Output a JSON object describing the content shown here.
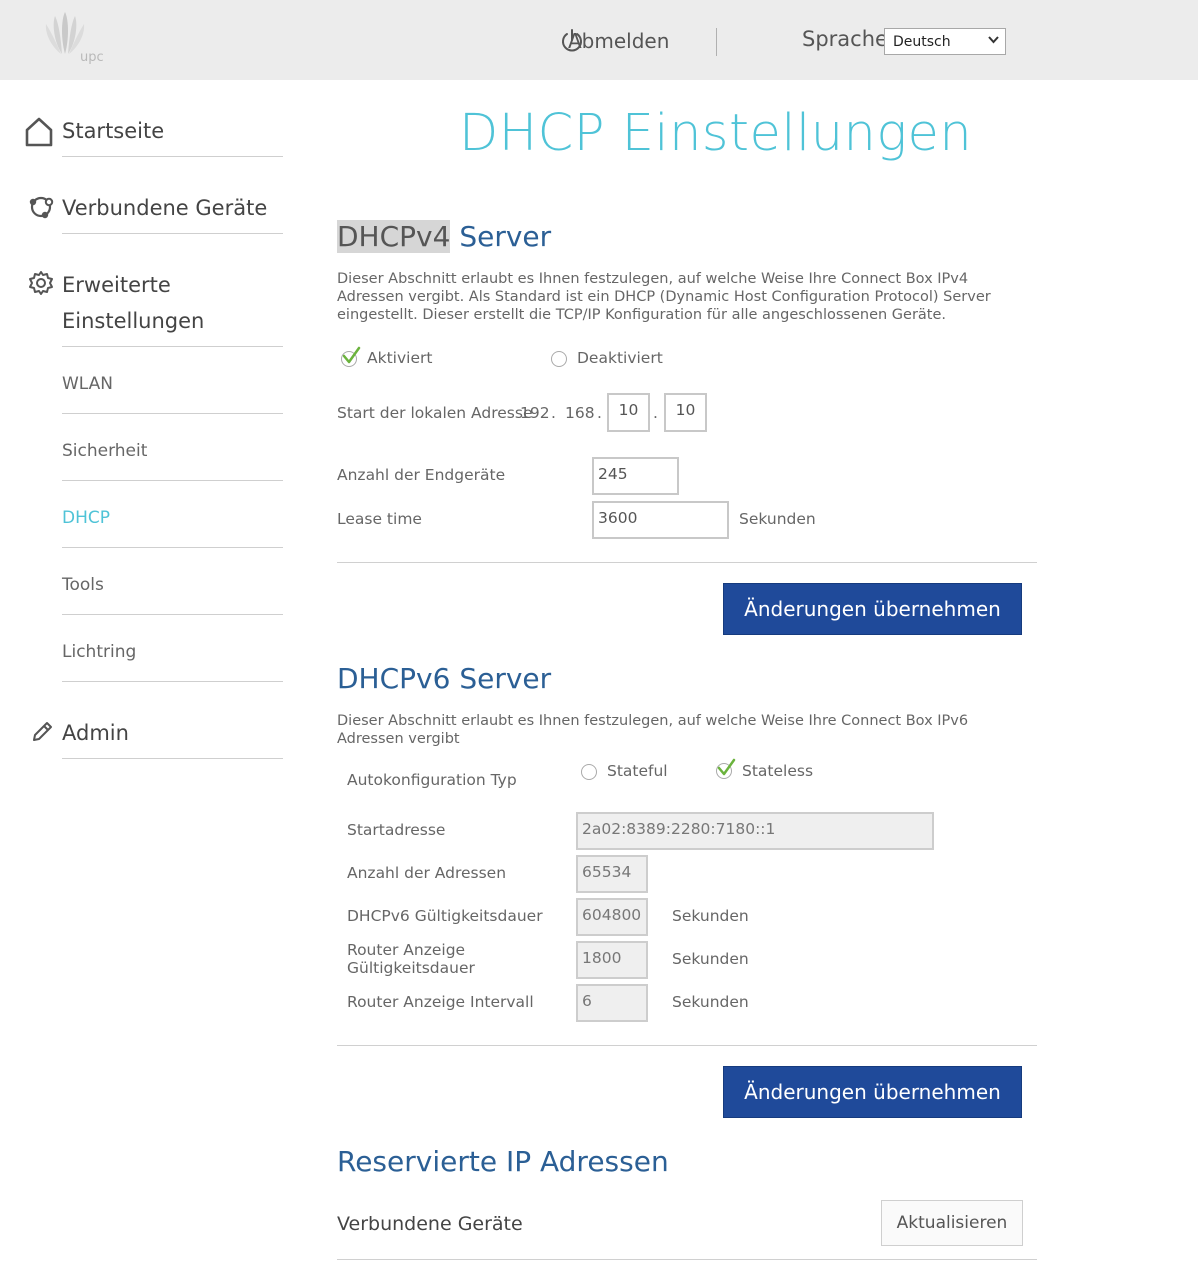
{
  "header": {
    "logo_text": "upc",
    "logout_label": "Abmelden",
    "language_label": "Sprache",
    "language_selected": "Deutsch"
  },
  "sidebar": {
    "items": [
      {
        "label": "Startseite"
      },
      {
        "label": "Verbundene Geräte"
      },
      {
        "label": "Erweiterte",
        "label2": "Einstellungen"
      },
      {
        "label": "WLAN"
      },
      {
        "label": "Sicherheit"
      },
      {
        "label": "DHCP"
      },
      {
        "label": "Tools"
      },
      {
        "label": "Lichtring"
      },
      {
        "label": "Admin"
      }
    ],
    "active_color": "#4fc3d7"
  },
  "main": {
    "title": "DHCP Einstellungen",
    "dhcpv4": {
      "title_highlight": "DHCPv4",
      "title_rest": " Server",
      "description": "Dieser Abschnitt erlaubt es Ihnen festzulegen, auf welche Weise Ihre Connect Box IPv4 Adressen vergibt. Als Standard ist ein DHCP (Dynamic Host Configuration Protocol) Server eingestellt. Dieser erstellt die TCP/IP Konfiguration für alle angeschlossenen Geräte.",
      "radio_enabled": "Aktiviert",
      "radio_disabled": "Deaktiviert",
      "selected": "Aktiviert",
      "start_address_label": "Start der lokalen Adresse",
      "ip_oct1": "192",
      "ip_dot1": ".",
      "ip_oct2": "168",
      "ip_dot2": ".",
      "ip_oct3": "10",
      "ip_dot3": ".",
      "ip_oct4": "10",
      "devices_label": "Anzahl der Endgeräte",
      "devices_value": "245",
      "lease_label": "Lease time",
      "lease_value": "3600",
      "lease_unit": "Sekunden",
      "apply_button": "Änderungen übernehmen"
    },
    "dhcpv6": {
      "title": "DHCPv6 Server",
      "description": "Dieser Abschnitt erlaubt es Ihnen festzulegen, auf welche Weise Ihre Connect Box IPv6 Adressen vergibt",
      "autoconf_label": "Autokonfiguration Typ",
      "radio_stateful": "Stateful",
      "radio_stateless": "Stateless",
      "selected": "Stateless",
      "start_label": "Startadresse",
      "start_value": "2a02:8389:2280:7180::1",
      "count_label": "Anzahl der Adressen",
      "count_value": "65534",
      "validity_label": "DHCPv6 Gültigkeitsdauer",
      "validity_value": "604800",
      "ra_validity_label": "Router Anzeige Gültigkeitsdauer",
      "ra_validity_value": "1800",
      "ra_interval_label": "Router Anzeige Intervall",
      "ra_interval_value": "6",
      "unit": "Sekunden",
      "apply_button": "Änderungen übernehmen"
    },
    "reserved": {
      "title": "Reservierte IP Adressen",
      "connected_label": "Verbundene Geräte",
      "refresh_button": "Aktualisieren"
    }
  }
}
